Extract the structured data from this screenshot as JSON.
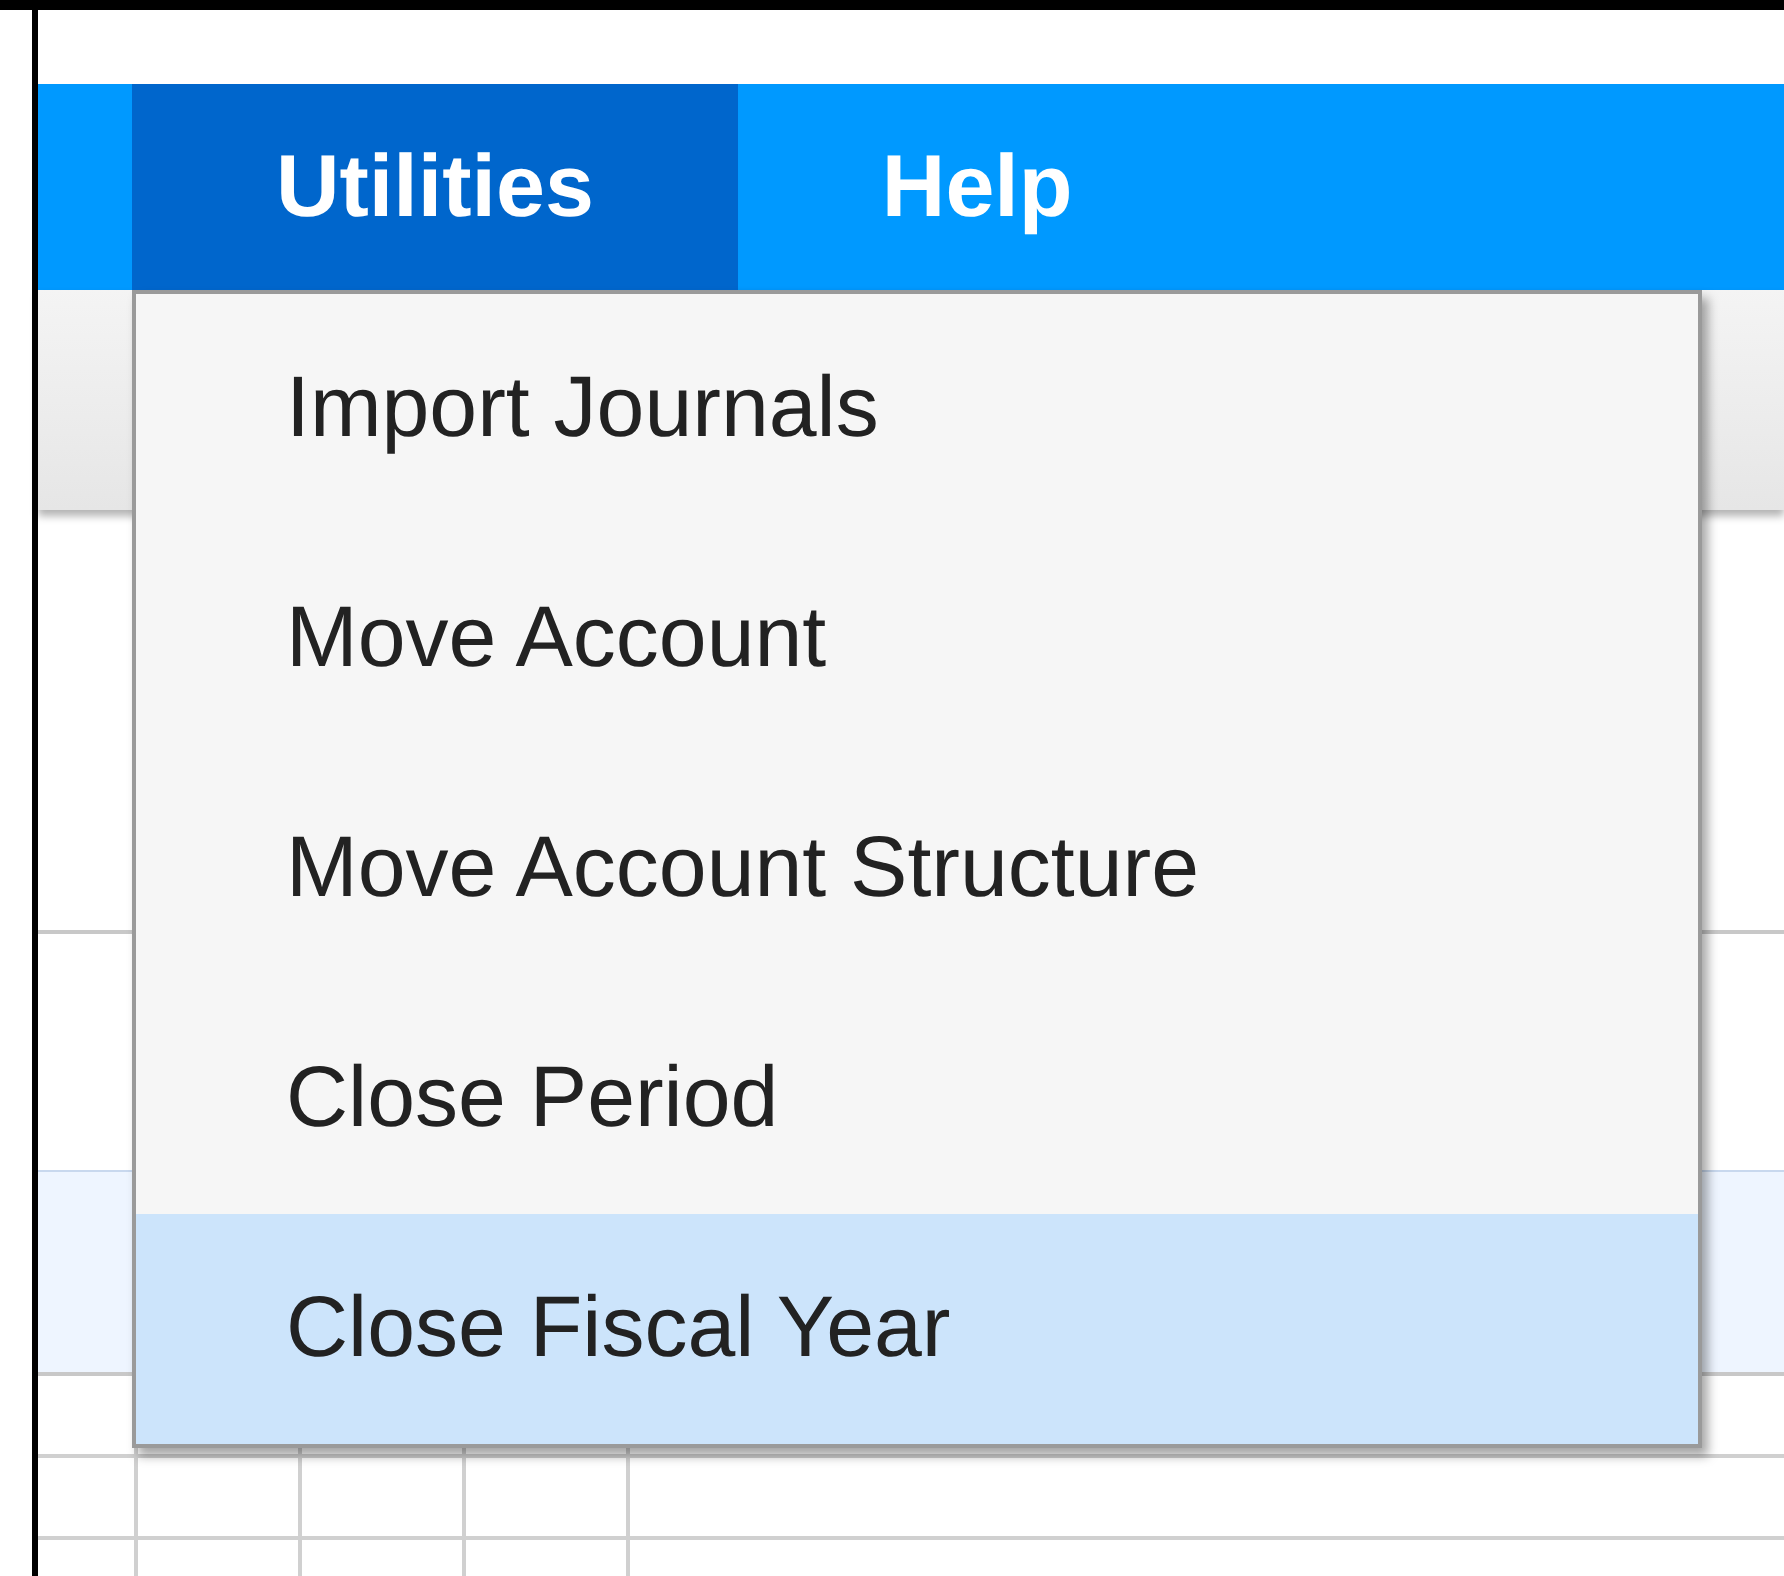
{
  "menubar": [
    {
      "label": "Utilities",
      "selected": true
    },
    {
      "label": "Help",
      "selected": false
    }
  ],
  "menu": {
    "items": [
      {
        "label": "Import Journals",
        "selected": false
      },
      {
        "label": "Move Account",
        "selected": false
      },
      {
        "label": "Move Account Structure",
        "selected": false
      },
      {
        "label": "Close Period",
        "selected": false
      },
      {
        "label": "Close Fiscal Year",
        "selected": true
      }
    ]
  }
}
